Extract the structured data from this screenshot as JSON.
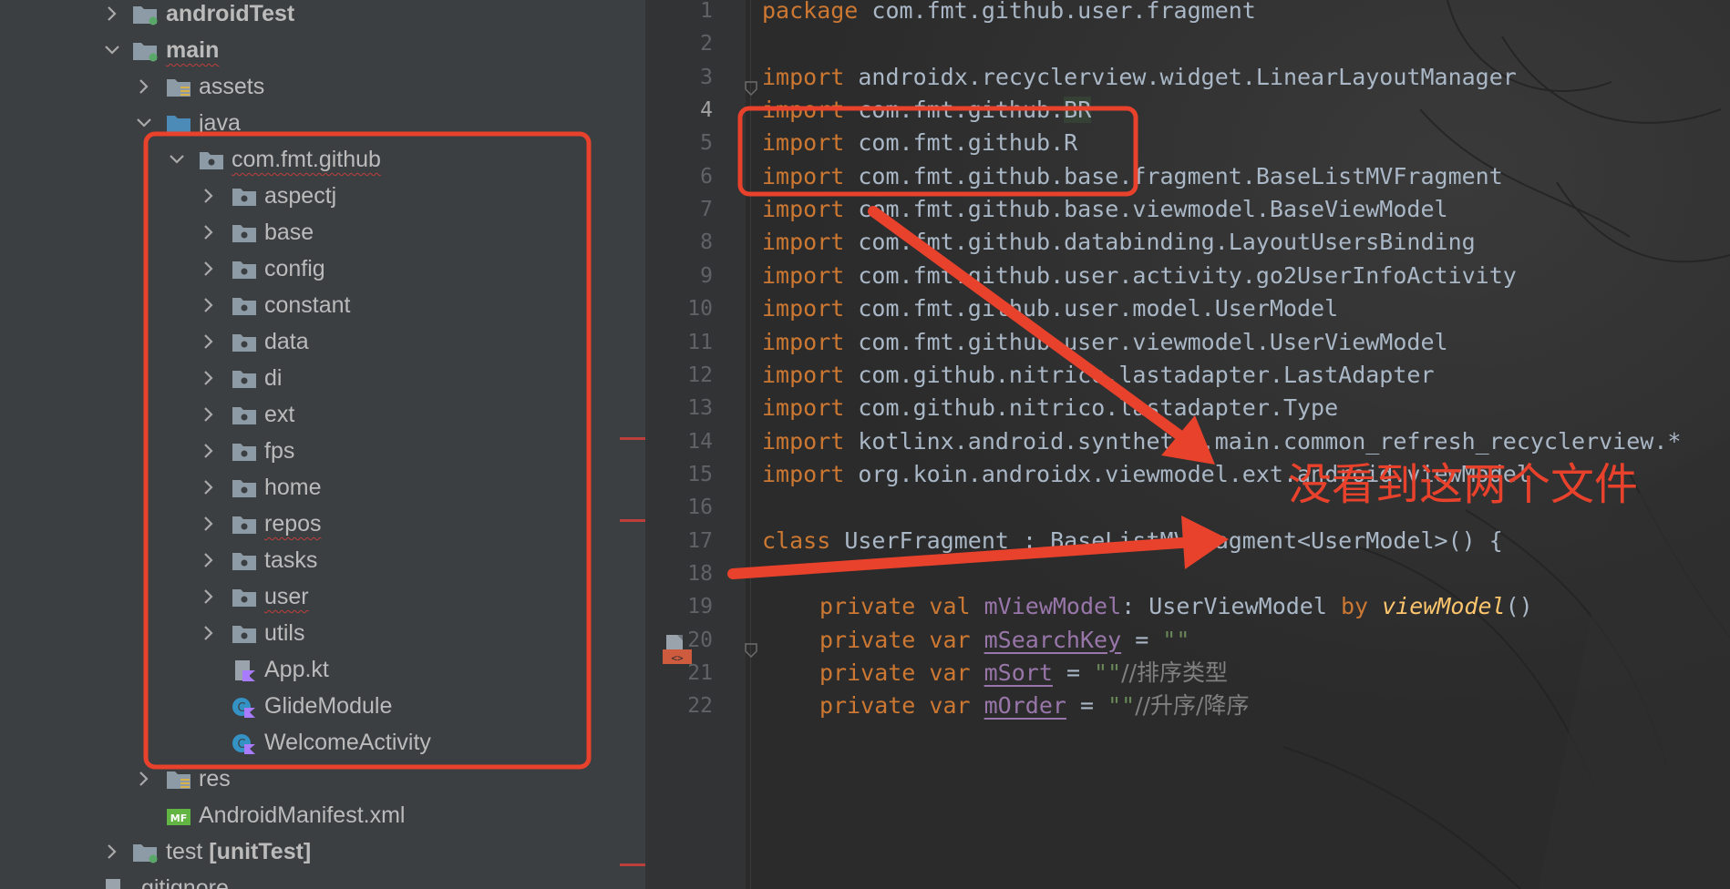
{
  "project_tree": {
    "items": [
      {
        "label": "androidTest",
        "bold": true
      },
      {
        "label": "main",
        "bold": true
      },
      {
        "label": "assets"
      },
      {
        "label": "java"
      },
      {
        "label": "com.fmt.github"
      },
      {
        "label": "aspectj"
      },
      {
        "label": "base"
      },
      {
        "label": "config"
      },
      {
        "label": "constant"
      },
      {
        "label": "data"
      },
      {
        "label": "di"
      },
      {
        "label": "ext"
      },
      {
        "label": "fps"
      },
      {
        "label": "home"
      },
      {
        "label": "repos"
      },
      {
        "label": "tasks"
      },
      {
        "label": "user"
      },
      {
        "label": "utils"
      },
      {
        "label": "App.kt"
      },
      {
        "label": "GlideModule"
      },
      {
        "label": "WelcomeActivity"
      },
      {
        "label": "res"
      },
      {
        "label": "AndroidManifest.xml"
      },
      {
        "label": "test",
        "suffix": "[unitTest]"
      },
      {
        "label": ".gitignore"
      }
    ]
  },
  "editor": {
    "lines": [
      {
        "n": "1",
        "t": [
          [
            "kw",
            "package"
          ],
          [
            "pl",
            " com.fmt.github.user.fragment"
          ]
        ]
      },
      {
        "n": "2",
        "t": []
      },
      {
        "n": "3",
        "t": [
          [
            "kw",
            "import"
          ],
          [
            "pl",
            " androidx.recyclerview.widget.LinearLayoutManager"
          ]
        ]
      },
      {
        "n": "4",
        "t": [
          [
            "kw",
            "import"
          ],
          [
            "pl",
            " com.fmt.github."
          ],
          [
            "hl",
            "BR"
          ]
        ],
        "active": true
      },
      {
        "n": "5",
        "t": [
          [
            "kw",
            "import"
          ],
          [
            "pl",
            " com.fmt.github.R"
          ]
        ]
      },
      {
        "n": "6",
        "t": [
          [
            "kw",
            "import"
          ],
          [
            "pl",
            " com.fmt.github.base.fragment.BaseListMVFragment"
          ]
        ]
      },
      {
        "n": "7",
        "t": [
          [
            "kw",
            "import"
          ],
          [
            "pl",
            " com.fmt.github.base.viewmodel.BaseViewModel"
          ]
        ]
      },
      {
        "n": "8",
        "t": [
          [
            "kw",
            "import"
          ],
          [
            "pl",
            " com.fmt.github.databinding.LayoutUsersBinding"
          ]
        ]
      },
      {
        "n": "9",
        "t": [
          [
            "kw",
            "import"
          ],
          [
            "pl",
            " com.fmt.github.user.activity.go2UserInfoActivity"
          ]
        ]
      },
      {
        "n": "10",
        "t": [
          [
            "kw",
            "import"
          ],
          [
            "pl",
            " com.fmt.github.user.model.UserModel"
          ]
        ]
      },
      {
        "n": "11",
        "t": [
          [
            "kw",
            "import"
          ],
          [
            "pl",
            " com.fmt.github.user.viewmodel.UserViewModel"
          ]
        ]
      },
      {
        "n": "12",
        "t": [
          [
            "kw",
            "import"
          ],
          [
            "pl",
            " com.github.nitrico.lastadapter.LastAdapter"
          ]
        ]
      },
      {
        "n": "13",
        "t": [
          [
            "kw",
            "import"
          ],
          [
            "pl",
            " com.github.nitrico.lastadapter.Type"
          ]
        ]
      },
      {
        "n": "14",
        "t": [
          [
            "kw",
            "import"
          ],
          [
            "pl",
            " kotlinx.android.synthetic.main.common_refresh_recyclerview.*"
          ]
        ]
      },
      {
        "n": "15",
        "t": [
          [
            "kw",
            "import"
          ],
          [
            "pl",
            " org.koin.androidx.viewmodel.ext.android.viewModel"
          ]
        ]
      },
      {
        "n": "16",
        "t": []
      },
      {
        "n": "17",
        "t": [
          [
            "kw",
            "class"
          ],
          [
            "pl",
            " UserFragment : BaseListMVFragment<UserModel>() {"
          ]
        ]
      },
      {
        "n": "18",
        "t": []
      },
      {
        "n": "19",
        "t": [
          [
            "kw",
            "private val "
          ],
          [
            "fld",
            "mViewModel"
          ],
          [
            "pl",
            ": UserViewModel "
          ],
          [
            "kw",
            "by "
          ],
          [
            "fn",
            "viewModel"
          ],
          [
            "pl",
            "()"
          ]
        ],
        "indent": true
      },
      {
        "n": "20",
        "t": [
          [
            "kw",
            "private var "
          ],
          [
            "fldu",
            "mSearchKey"
          ],
          [
            "pl",
            " = "
          ],
          [
            "str",
            "\"\""
          ]
        ],
        "indent": true
      },
      {
        "n": "21",
        "t": [
          [
            "kw",
            "private var "
          ],
          [
            "fldu",
            "mSort"
          ],
          [
            "pl",
            " = "
          ],
          [
            "str",
            "\"\""
          ],
          [
            "cm",
            "//排序类型"
          ]
        ],
        "indent": true
      },
      {
        "n": "22",
        "t": [
          [
            "kw",
            "private var "
          ],
          [
            "fldu",
            "mOrder"
          ],
          [
            "pl",
            " = "
          ],
          [
            "str",
            "\"\""
          ],
          [
            "cm",
            "//升序/降序"
          ]
        ],
        "indent": true
      }
    ]
  },
  "annotation": {
    "note": "没看到这两个文件",
    "color": "#e8412c"
  }
}
